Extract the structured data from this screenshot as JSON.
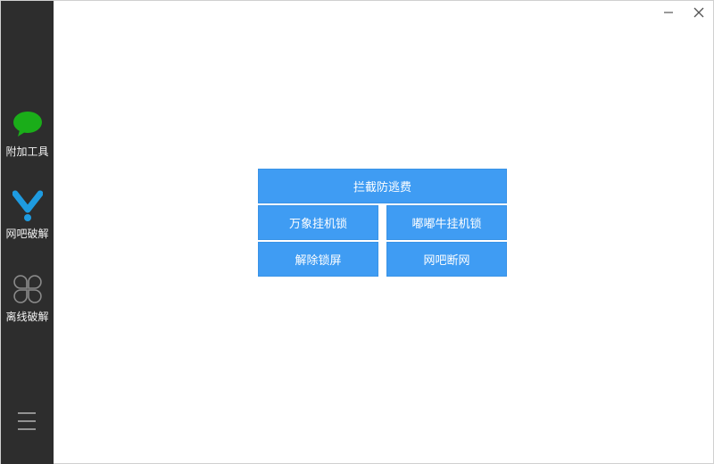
{
  "sidebar": {
    "items": [
      {
        "label": "附加工具",
        "icon": "chat-bubble-icon",
        "color": "#1aad19"
      },
      {
        "label": "网吧破解",
        "icon": "check-pin-icon",
        "color": "#1e9be0"
      },
      {
        "label": "离线破解",
        "icon": "clover-icon",
        "color": "#8a8a8a"
      }
    ],
    "menu_icon": "hamburger-menu-icon"
  },
  "window_controls": {
    "minimize_icon": "minimize-icon",
    "close_icon": "close-icon"
  },
  "buttons": {
    "intercept_anti_escape": "拦截防逃费",
    "wanxiang_hang_lock": "万象挂机锁",
    "dudu_niu_hang_lock": "嘟嘟牛挂机锁",
    "unlock_screen": "解除锁屏",
    "netbar_disconnect": "网吧断网"
  },
  "colors": {
    "sidebar_bg": "#2d2d2d",
    "button_bg": "#3f9cf3"
  }
}
